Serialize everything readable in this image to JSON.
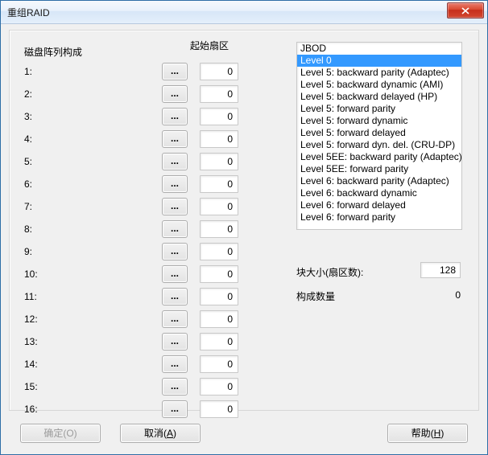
{
  "window": {
    "title": "重组RAID"
  },
  "headers": {
    "composition": "磁盘阵列构成",
    "start_sector": "起始扇区"
  },
  "rows": [
    {
      "label": "1:",
      "value": "0"
    },
    {
      "label": "2:",
      "value": "0"
    },
    {
      "label": "3:",
      "value": "0"
    },
    {
      "label": "4:",
      "value": "0"
    },
    {
      "label": "5:",
      "value": "0"
    },
    {
      "label": "6:",
      "value": "0"
    },
    {
      "label": "7:",
      "value": "0"
    },
    {
      "label": "8:",
      "value": "0"
    },
    {
      "label": "9:",
      "value": "0"
    },
    {
      "label": "10:",
      "value": "0"
    },
    {
      "label": "11:",
      "value": "0"
    },
    {
      "label": "12:",
      "value": "0"
    },
    {
      "label": "13:",
      "value": "0"
    },
    {
      "label": "14:",
      "value": "0"
    },
    {
      "label": "15:",
      "value": "0"
    },
    {
      "label": "16:",
      "value": "0"
    }
  ],
  "browse_label": "...",
  "raid_levels": {
    "selected_index": 1,
    "items": [
      "JBOD",
      "Level 0",
      "Level 5: backward parity (Adaptec)",
      "Level 5: backward dynamic (AMI)",
      "Level 5: backward delayed (HP)",
      "Level 5: forward parity",
      "Level 5: forward dynamic",
      "Level 5: forward delayed",
      "Level 5: forward dyn. del. (CRU-DP)",
      "Level 5EE: backward parity (Adaptec)",
      "Level 5EE: forward parity",
      "Level 6: backward parity (Adaptec)",
      "Level 6: backward dynamic",
      "Level 6: forward delayed",
      "Level 6: forward parity"
    ]
  },
  "right": {
    "block_size_label": "块大小(扇区数):",
    "block_size_value": "128",
    "component_count_label": "构成数量",
    "component_count_value": "0"
  },
  "buttons": {
    "ok": "确定(O)",
    "cancel_pre": "取消(",
    "cancel_u": "A",
    "cancel_post": ")",
    "help_pre": "帮助(",
    "help_u": "H",
    "help_post": ")"
  }
}
